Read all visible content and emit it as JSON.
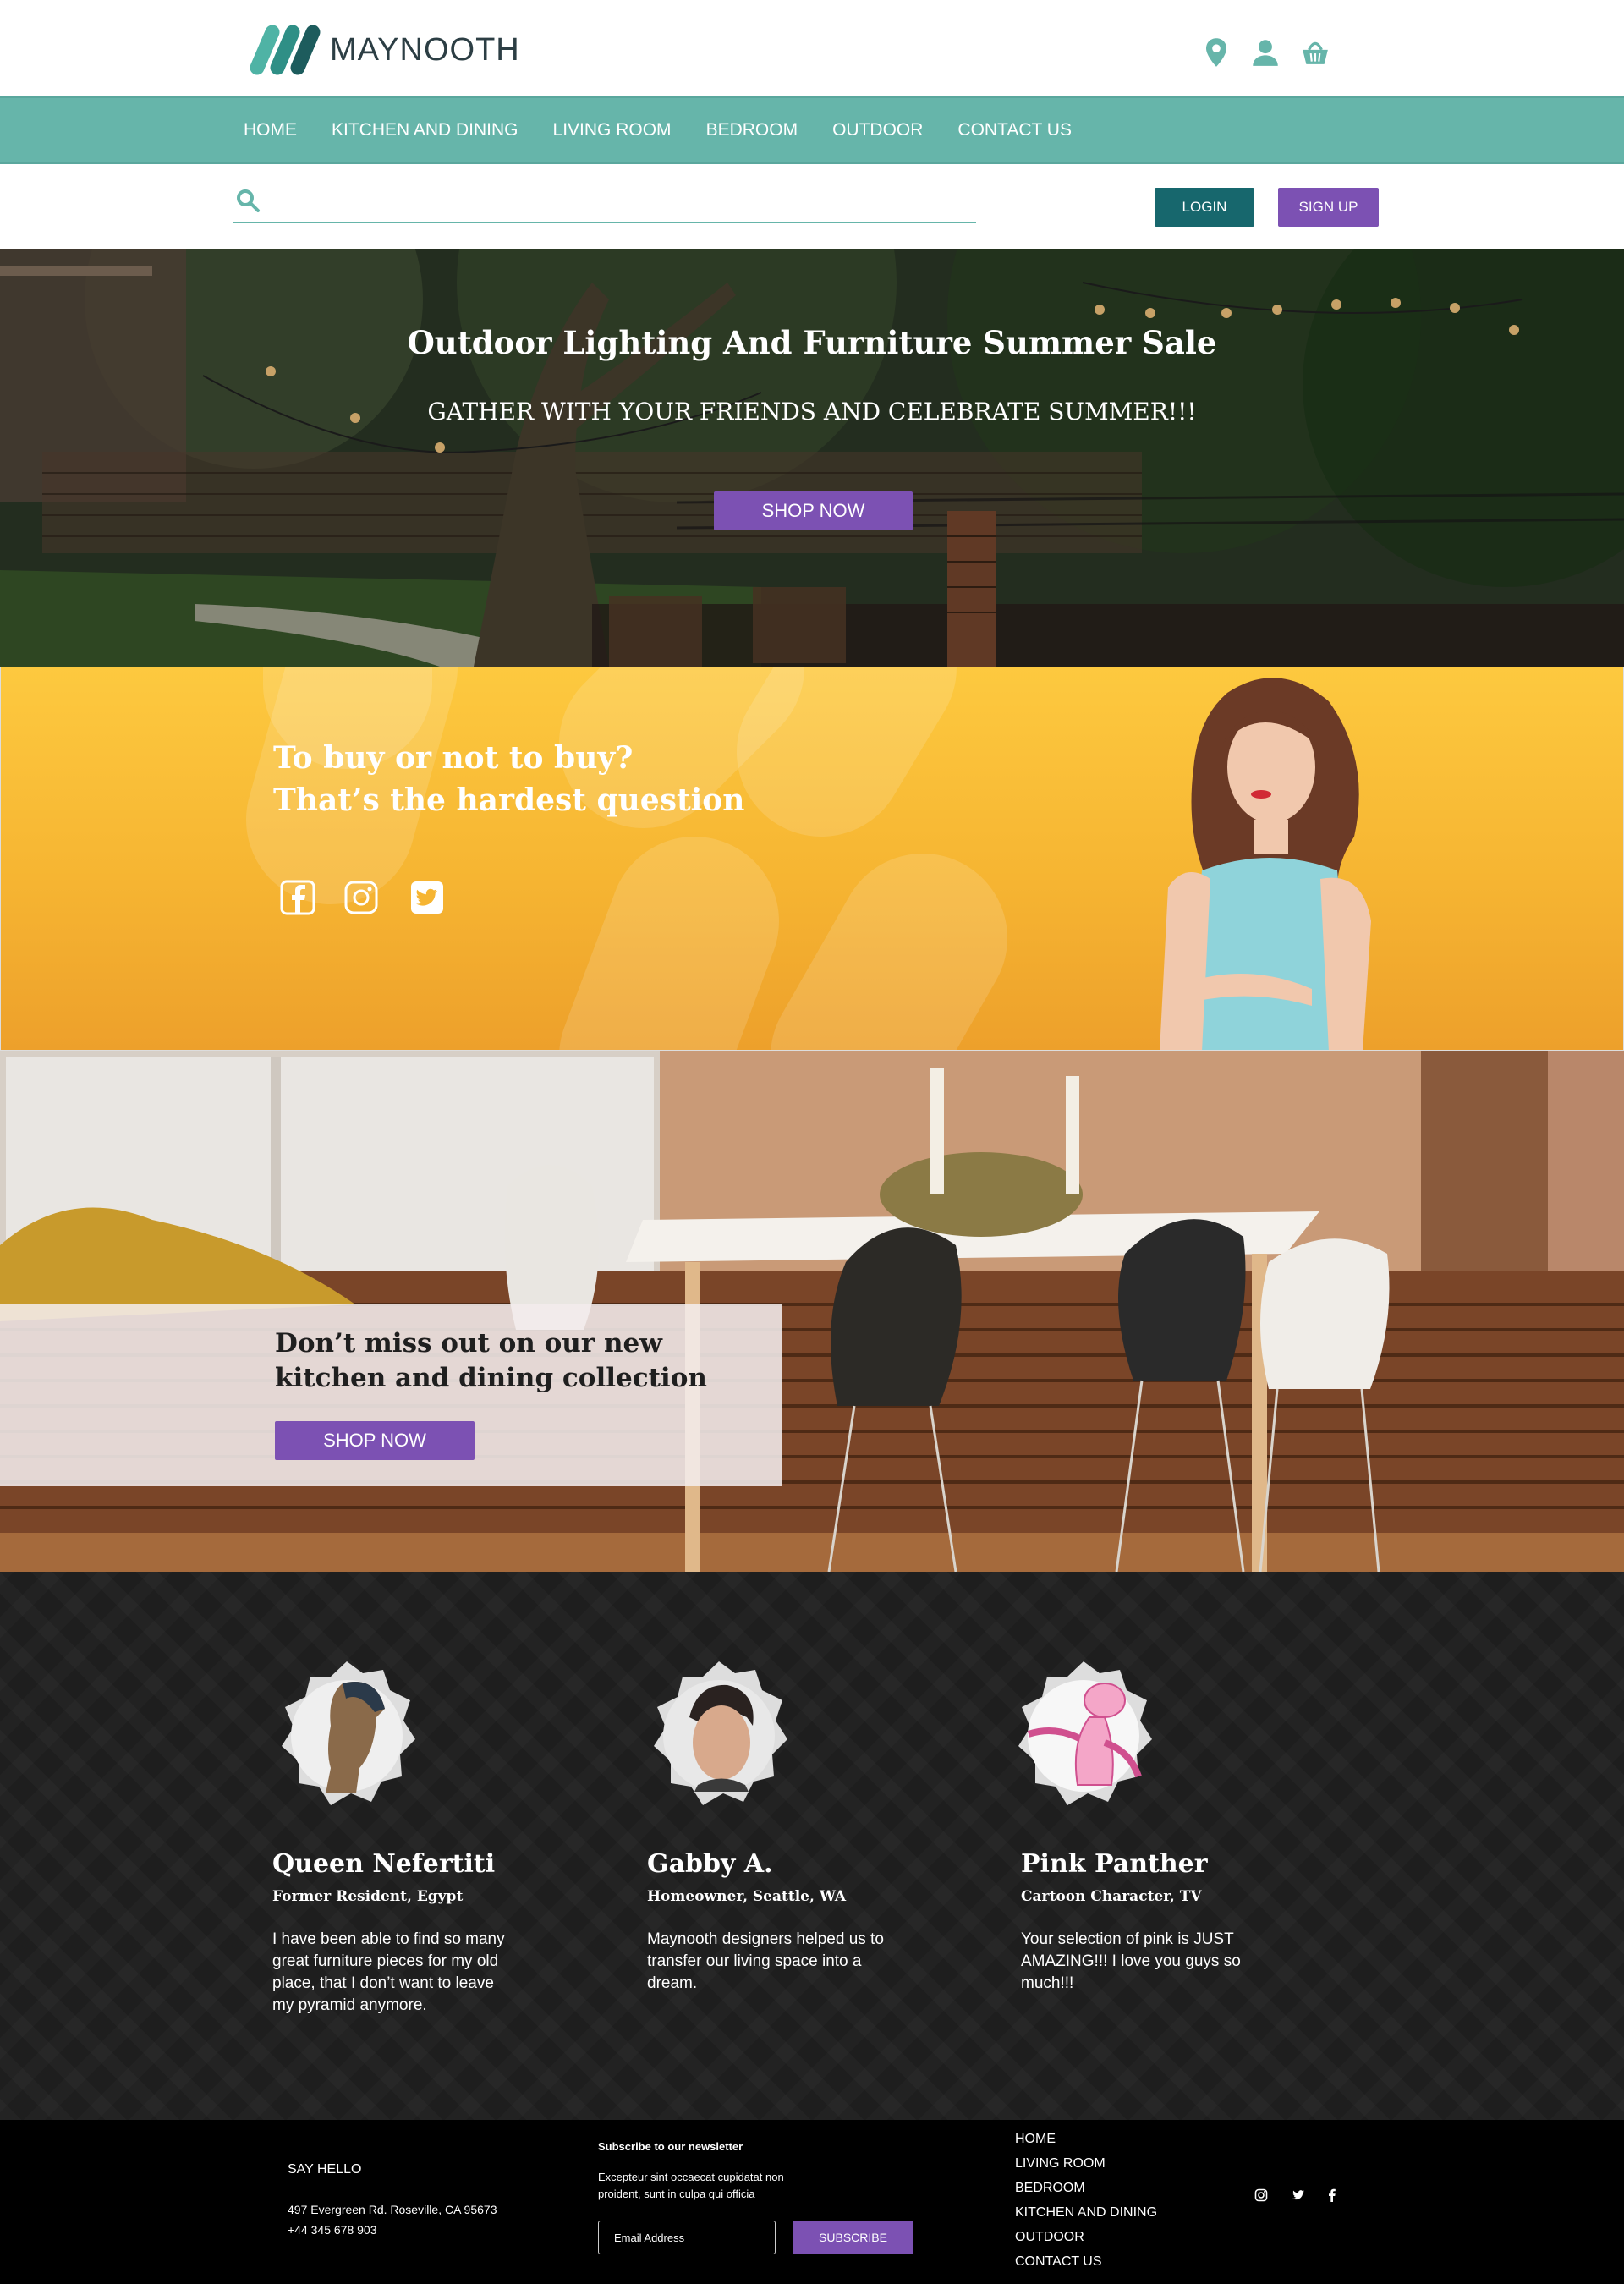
{
  "brand": {
    "name": "MAYNOOTH",
    "teal": "#66b5aa",
    "dark_teal": "#17676d",
    "purple": "#7c51b3"
  },
  "header_icons": [
    "location-pin-icon",
    "user-icon",
    "shopping-basket-icon"
  ],
  "nav": [
    "HOME",
    "KITCHEN AND DINING",
    "LIVING ROOM",
    "BEDROOM",
    "OUTDOOR",
    "CONTACT US"
  ],
  "search": {
    "placeholder": ""
  },
  "auth": {
    "login": "LOGIN",
    "signup": "SIGN UP"
  },
  "hero": {
    "title": "Outdoor Lighting And Furniture Summer Sale",
    "subtitle": "GATHER WITH YOUR FRIENDS AND CELEBRATE SUMMER!!!",
    "button": "SHOP NOW"
  },
  "promo": {
    "line1": "To buy or not to buy?",
    "line2": "That’s the hardest question",
    "social": [
      "facebook-icon",
      "instagram-icon",
      "twitter-icon"
    ],
    "background": "#f6b532"
  },
  "dining": {
    "line1": "Don’t miss out on our new",
    "line2": "kitchen and dining collection",
    "button": "SHOP NOW"
  },
  "testimonials": [
    {
      "name": "Queen Nefertiti",
      "role": "Former Resident, Egypt",
      "quote": [
        "I have been able to find so many",
        "great furniture pieces for my old",
        "place, that I don’t want to leave",
        "my pyramid anymore."
      ]
    },
    {
      "name": "Gabby A.",
      "role": "Homeowner, Seattle, WA",
      "quote": [
        "Maynooth designers helped us to",
        "transfer our living space into a",
        "dream."
      ]
    },
    {
      "name": "Pink Panther",
      "role": "Cartoon Character, TV",
      "quote": [
        "Your selection of pink is JUST",
        "AMAZING!!! I love you guys so",
        "much!!!"
      ]
    }
  ],
  "footer": {
    "say_hello": "SAY HELLO",
    "address": "497 Evergreen Rd. Roseville, CA 95673",
    "phone": "+44 345 678 903",
    "newsletter_title": "Subscribe to our newsletter",
    "newsletter_body": "Excepteur sint occaecat cupidatat non proident, sunt in culpa qui officia",
    "email_placeholder": "Email Address",
    "subscribe": "SUBSCRIBE",
    "links": [
      "HOME",
      "LIVING ROOM",
      "BEDROOM",
      "KITCHEN AND DINING",
      "OUTDOOR",
      "CONTACT US"
    ],
    "social": [
      "instagram-icon",
      "twitter-icon",
      "facebook-icon"
    ]
  }
}
